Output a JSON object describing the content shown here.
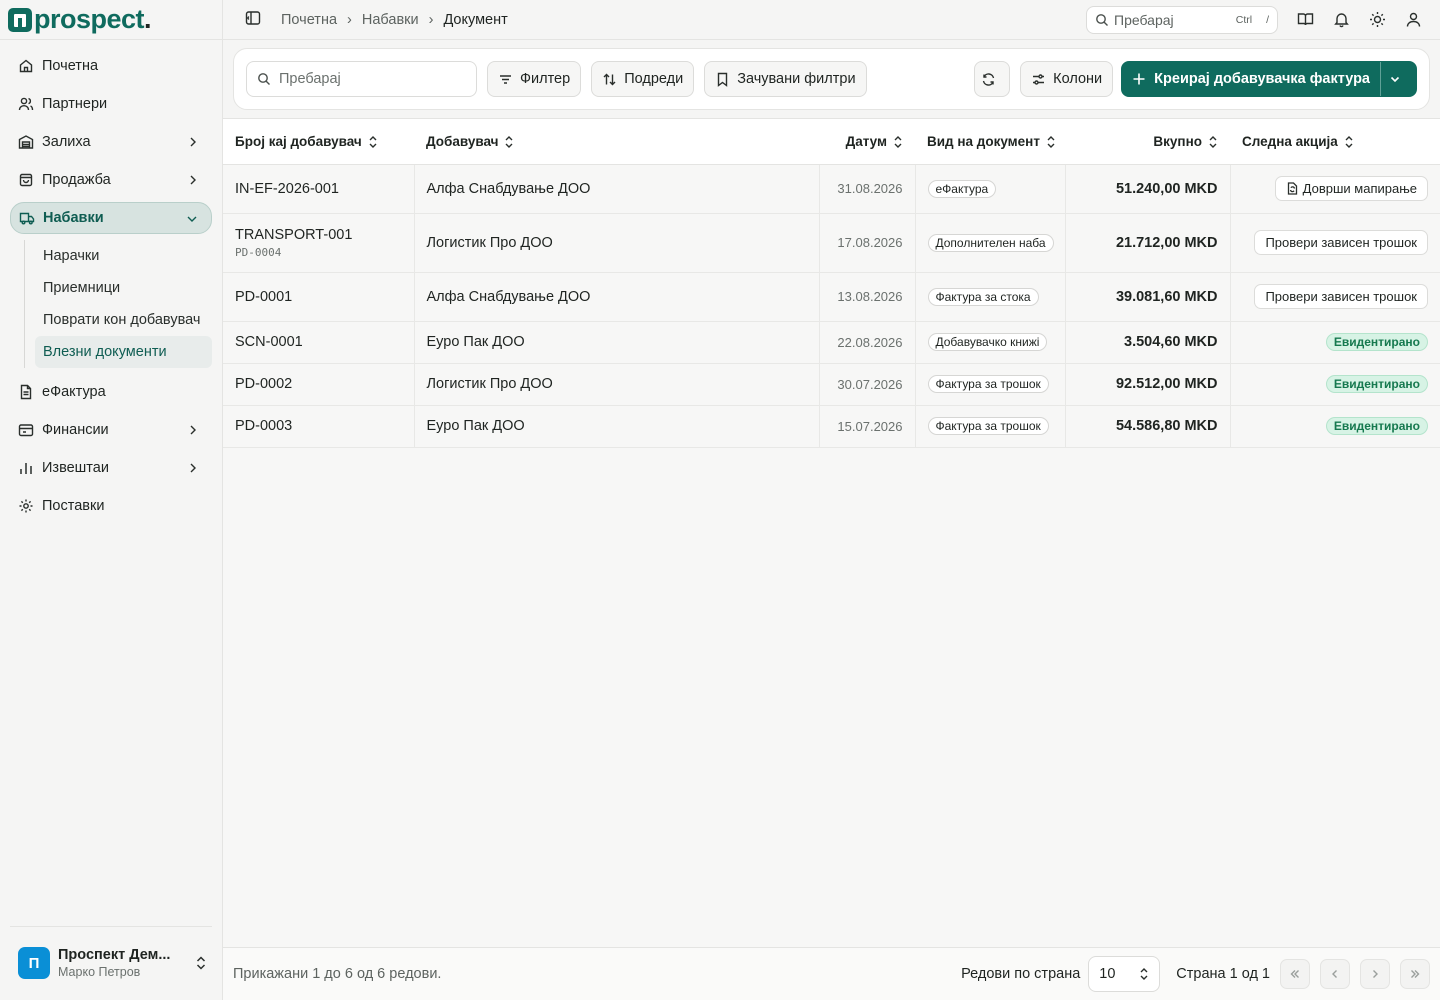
{
  "brand": {
    "logo_text": "prospect",
    "logo_dot": "."
  },
  "sidebar": {
    "items": [
      {
        "label": "Почетна",
        "icon": "home-icon"
      },
      {
        "label": "Партнери",
        "icon": "users-icon"
      },
      {
        "label": "Залиха",
        "icon": "warehouse-icon"
      },
      {
        "label": "Продажба",
        "icon": "shopping-bag-icon"
      },
      {
        "label": "Набавки",
        "icon": "truck-icon"
      },
      {
        "label": "еФактура",
        "icon": "file-text-icon"
      },
      {
        "label": "Финансии",
        "icon": "wallet-icon"
      },
      {
        "label": "Извештаи",
        "icon": "bar-chart-icon"
      },
      {
        "label": "Поставки",
        "icon": "settings-icon"
      }
    ],
    "subitems": [
      {
        "label": "Нарачки"
      },
      {
        "label": "Приемници"
      },
      {
        "label": "Поврати кон добавувач"
      },
      {
        "label": "Влезни документи"
      }
    ],
    "org": {
      "avatar_letter": "П",
      "name": "Проспект Дем...",
      "user": "Марко Петров"
    }
  },
  "topbar": {
    "breadcrumb": [
      "Почетна",
      "Набавки",
      "Документ"
    ],
    "search_placeholder": "Пребарај",
    "kbd_ctrl": "Ctrl",
    "kbd_key": "/"
  },
  "toolbar": {
    "search_placeholder": "Пребарај",
    "filter": "Филтер",
    "sort": "Подреди",
    "saved_filters": "Зачувани филтри",
    "columns": "Колони",
    "create": "Креирај добавувачка фактура"
  },
  "table": {
    "headers": [
      "Број кај добавувач",
      "Добавувач",
      "Датум",
      "Вид на документ",
      "Вкупно",
      "Следна акција"
    ],
    "rows": [
      {
        "number": "IN-EF-2026-001",
        "sub": "",
        "supplier": "Алфа Снабдување ДОО",
        "date": "31.08.2026",
        "type": "еФактура",
        "total": "51.240,00 MKD",
        "action": "Доврши мапирање",
        "action_kind": "button-icon"
      },
      {
        "number": "TRANSPORT-001",
        "sub": "PD-0004",
        "supplier": "Логистик Про ДОО",
        "date": "17.08.2026",
        "type": "Дополнителен наба",
        "total": "21.712,00 MKD",
        "action": "Провери зависен трошок",
        "action_kind": "button"
      },
      {
        "number": "PD-0001",
        "sub": "",
        "supplier": "Алфа Снабдување ДОО",
        "date": "13.08.2026",
        "type": "Фактура за стока",
        "total": "39.081,60 MKD",
        "action": "Провери зависен трошок",
        "action_kind": "button"
      },
      {
        "number": "SCN-0001",
        "sub": "",
        "supplier": "Еуро Пак ДОО",
        "date": "22.08.2026",
        "type": "Добавувачко книжі",
        "total": "3.504,60 MKD",
        "action": "Евидентирано",
        "action_kind": "status"
      },
      {
        "number": "PD-0002",
        "sub": "",
        "supplier": "Логистик Про ДОО",
        "date": "30.07.2026",
        "type": "Фактура за трошок",
        "total": "92.512,00 MKD",
        "action": "Евидентирано",
        "action_kind": "status"
      },
      {
        "number": "PD-0003",
        "sub": "",
        "supplier": "Еуро Пак ДОО",
        "date": "15.07.2026",
        "type": "Фактура за трошок",
        "total": "54.586,80 MKD",
        "action": "Евидентирано",
        "action_kind": "status"
      }
    ]
  },
  "footer": {
    "info": "Прикажани 1 до 6 од 6 редови.",
    "rows_label": "Редови по страна",
    "rows_value": "10",
    "page_label": "Страна 1 од 1"
  },
  "colors": {
    "accent": "#0f6b5e",
    "status_bg": "#d7f3e5",
    "status_fg": "#16794f",
    "avatar": "#0a8fd6"
  }
}
